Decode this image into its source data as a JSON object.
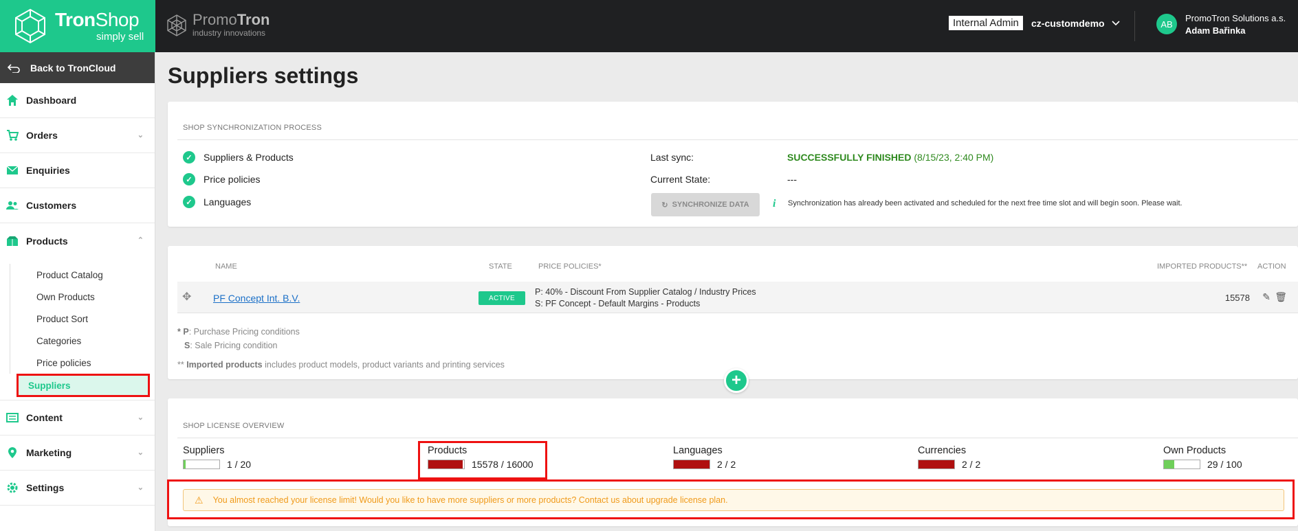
{
  "brand": {
    "name_bold": "Tron",
    "name_light": "Shop",
    "tagline": "simply sell"
  },
  "partner": {
    "name_light": "Promo",
    "name_bold": "Tron",
    "tagline": "industry innovations"
  },
  "header": {
    "role_badge": "Internal Admin",
    "tenant": "cz-customdemo",
    "avatar_initials": "AB",
    "company": "PromoTron Solutions a.s.",
    "user_name": "Adam Bařinka"
  },
  "sidebar": {
    "back_label": "Back to TronCloud",
    "items": [
      {
        "label": "Dashboard",
        "icon": "home-icon"
      },
      {
        "label": "Orders",
        "icon": "cart-icon"
      },
      {
        "label": "Enquiries",
        "icon": "envelope-icon"
      },
      {
        "label": "Customers",
        "icon": "users-icon"
      },
      {
        "label": "Products",
        "icon": "boxes-icon"
      },
      {
        "label": "Content",
        "icon": "content-icon"
      },
      {
        "label": "Marketing",
        "icon": "pin-icon"
      },
      {
        "label": "Settings",
        "icon": "gear-icon"
      }
    ],
    "products_sub": [
      "Product Catalog",
      "Own Products",
      "Product Sort",
      "Categories",
      "Price policies",
      "Suppliers"
    ]
  },
  "page": {
    "title": "Suppliers settings"
  },
  "sync": {
    "heading": "SHOP SYNCHRONIZATION PROCESS",
    "checks": [
      "Suppliers & Products",
      "Price policies",
      "Languages"
    ],
    "last_sync_label": "Last sync:",
    "last_sync_status": "SUCCESSFULLY FINISHED",
    "last_sync_date": "(8/15/23, 2:40 PM)",
    "current_state_label": "Current State:",
    "current_state_value": "---",
    "button_label": "SYNCHRONIZE DATA",
    "note": "Synchronization has already been activated and scheduled for the next free time slot and will begin soon. Please wait."
  },
  "suppliers_table": {
    "columns": [
      "NAME",
      "STATE",
      "PRICE POLICIES*",
      "IMPORTED PRODUCTS**",
      "ACTION"
    ],
    "rows": [
      {
        "name": "PF Concept Int. B.V.",
        "state": "ACTIVE",
        "policy_p": "P: 40% - Discount From Supplier Catalog / Industry Prices",
        "policy_s": "S: PF Concept - Default Margins - Products",
        "imported": "15578"
      }
    ],
    "foot_p_prefix": "* P",
    "foot_p_text": ": Purchase Pricing conditions",
    "foot_s_prefix": "S",
    "foot_s_text": ": Sale Pricing condition",
    "foot_imported_prefix": "** ",
    "foot_imported_bold": "Imported products",
    "foot_imported_text": " includes product models, product variants and printing services"
  },
  "license": {
    "heading": "SHOP LICENSE OVERVIEW",
    "items": [
      {
        "label": "Suppliers",
        "count": "1 / 20",
        "fill": 0.05,
        "color": "#6fcf5a"
      },
      {
        "label": "Products",
        "count": "15578 / 16000",
        "fill": 0.97,
        "color": "#b01010"
      },
      {
        "label": "Languages",
        "count": "2 / 2",
        "fill": 1.0,
        "color": "#b01010"
      },
      {
        "label": "Currencies",
        "count": "2 / 2",
        "fill": 1.0,
        "color": "#b01010"
      },
      {
        "label": "Own Products",
        "count": "29 / 100",
        "fill": 0.29,
        "color": "#6fcf5a"
      }
    ],
    "warning": "You almost reached your license limit! Would you like to have more suppliers or more products? Contact us about upgrade license plan."
  },
  "colors": {
    "accent": "#1ec88c",
    "danger": "#b01010",
    "ok": "#6fcf5a",
    "highlight": "#e11111"
  }
}
